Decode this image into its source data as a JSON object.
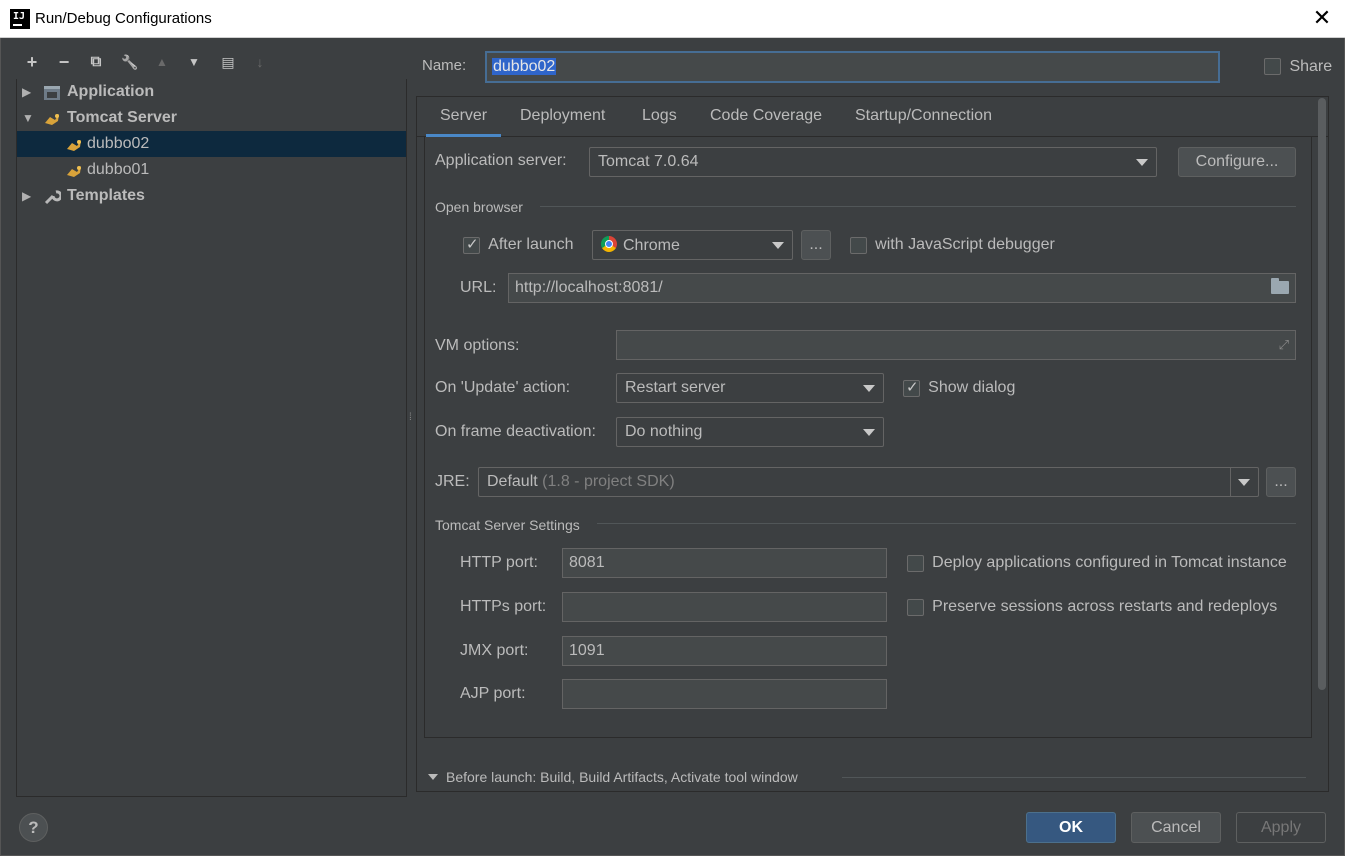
{
  "window": {
    "title": "Run/Debug Configurations",
    "close_glyph": "✕"
  },
  "toolbar": {
    "add": "+",
    "remove": "−",
    "copy": "⧉",
    "edit": "🔧",
    "up": "▲",
    "down": "▼",
    "folder": "▤",
    "sort": "↓"
  },
  "tree": {
    "application": "Application",
    "tomcat_server": "Tomcat Server",
    "dubbo02": "dubbo02",
    "dubbo01": "dubbo01",
    "templates": "Templates"
  },
  "name_field": {
    "label": "Name:",
    "value": "dubbo02"
  },
  "share": {
    "label": "Share",
    "checked": false
  },
  "tabs": [
    "Server",
    "Deployment",
    "Logs",
    "Code Coverage",
    "Startup/Connection"
  ],
  "server": {
    "app_server_label": "Application server:",
    "app_server_value": "Tomcat 7.0.64",
    "configure_button": "Configure...",
    "open_browser_title": "Open browser",
    "after_launch_label": "After launch",
    "browser": "Chrome",
    "browse_button": "...",
    "js_debugger_label": "with JavaScript debugger",
    "url_label": "URL:",
    "url_value": "http://localhost:8081/",
    "vm_options_label": "VM options:",
    "vm_options_value": "",
    "on_update_label": "On 'Update' action:",
    "on_update_value": "Restart server",
    "show_dialog_label": "Show dialog",
    "on_frame_label": "On frame deactivation:",
    "on_frame_value": "Do nothing",
    "jre_label": "JRE:",
    "jre_value": "Default",
    "jre_hint": "(1.8 - project SDK)",
    "jre_browse": "...",
    "tomcat_settings_title": "Tomcat Server Settings",
    "http_port_label": "HTTP port:",
    "http_port_value": "8081",
    "https_port_label": "HTTPs port:",
    "https_port_value": "",
    "jmx_port_label": "JMX port:",
    "jmx_port_value": "1091",
    "ajp_port_label": "AJP port:",
    "ajp_port_value": "",
    "deploy_apps_label": "Deploy applications configured in Tomcat instance",
    "preserve_sessions_label": "Preserve sessions across restarts and redeploys"
  },
  "before_launch": "Before launch: Build, Build Artifacts, Activate tool window",
  "footer": {
    "help": "?",
    "ok": "OK",
    "cancel": "Cancel",
    "apply": "Apply"
  },
  "colors": {
    "background": "#3c3f41",
    "selection": "#0d293e",
    "accent": "#4a88c7",
    "ok_button": "#365880"
  }
}
